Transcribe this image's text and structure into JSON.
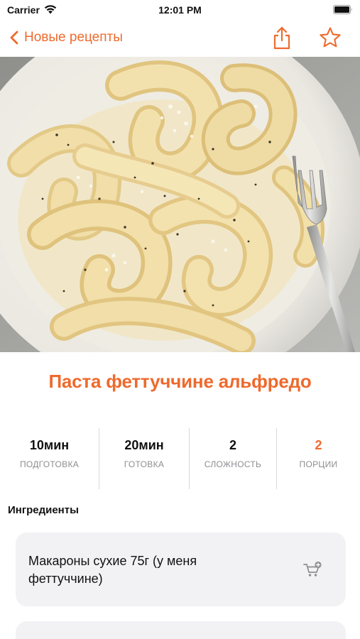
{
  "status_bar": {
    "carrier": "Carrier",
    "time": "12:01 PM",
    "icons": [
      "wifi-icon",
      "battery-icon"
    ]
  },
  "nav": {
    "back_label": "Новые рецепты",
    "back_icon": "chevron-left-icon",
    "share_icon": "share-icon",
    "favorite_icon": "star-icon"
  },
  "colors": {
    "accent": "#ee6a2d",
    "card_background": "#f2f2f4",
    "secondary_text": "#8e8e93"
  },
  "hero": {
    "image_subject": "fettuccine alfredo with grated cheese, black pepper and a fork on a white plate"
  },
  "recipe": {
    "title": "Паста феттуччине альфредо"
  },
  "stats": [
    {
      "value": "10мин",
      "label": "ПОДГОТОВКА"
    },
    {
      "value": "20мин",
      "label": "ГОТОВКА"
    },
    {
      "value": "2",
      "label": "СЛОЖНОСТЬ"
    },
    {
      "value": "2",
      "label": "ПОРЦИИ"
    }
  ],
  "ingredients": {
    "title": "Ингредиенты",
    "items": [
      {
        "text": "Макароны сухие 75г (у меня феттуччине)",
        "action_icon": "cart-add-icon"
      },
      {
        "text": ""
      }
    ]
  }
}
